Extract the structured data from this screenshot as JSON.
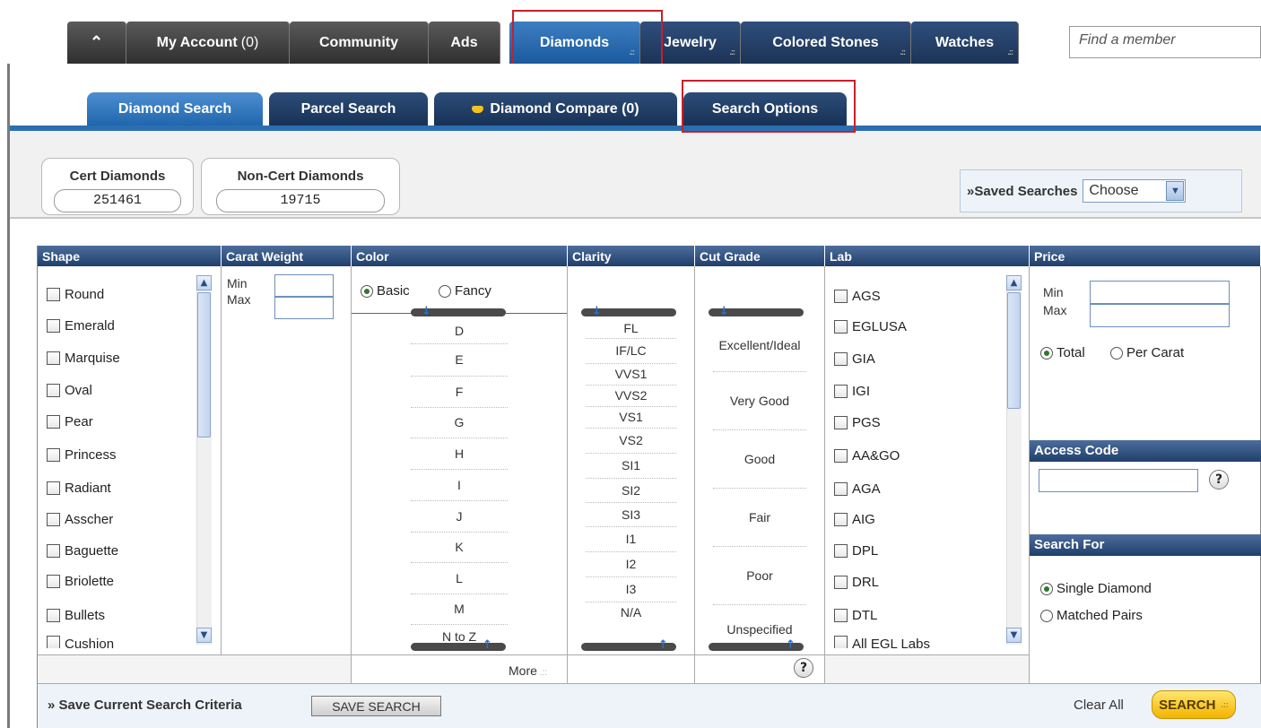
{
  "topnav": {
    "home_icon": "home-icon",
    "my_account": "My Account",
    "my_account_count": "(0)",
    "community": "Community",
    "ads": "Ads",
    "diamonds": "Diamonds",
    "jewelry": "Jewelry",
    "colored_stones": "Colored Stones",
    "watches": "Watches",
    "find_placeholder": "Find a member"
  },
  "subtabs": {
    "diamond_search": "Diamond Search",
    "parcel_search": "Parcel Search",
    "diamond_compare": "Diamond Compare (0)",
    "search_options": "Search Options"
  },
  "counts": {
    "cert_label": "Cert Diamonds",
    "cert_value": "251461",
    "noncert_label": "Non-Cert Diamonds",
    "noncert_value": "19715"
  },
  "saved": {
    "label": "Saved Searches",
    "prefix": "»",
    "choose": "Choose"
  },
  "headers": {
    "shape": "Shape",
    "carat": "Carat Weight",
    "color": "Color",
    "clarity": "Clarity",
    "cut": "Cut Grade",
    "lab": "Lab",
    "price": "Price"
  },
  "shapes": [
    "Round",
    "Emerald",
    "Marquise",
    "Oval",
    "Pear",
    "Princess",
    "Radiant",
    "Asscher",
    "Baguette",
    "Briolette",
    "Bullets",
    "Cushion"
  ],
  "carat": {
    "min": "Min",
    "max": "Max"
  },
  "color_mode": {
    "basic": "Basic",
    "fancy": "Fancy"
  },
  "colors": [
    "D",
    "E",
    "F",
    "G",
    "H",
    "I",
    "J",
    "K",
    "L",
    "M",
    "N to Z"
  ],
  "color_more": "More",
  "clarity": [
    "FL",
    "IF/LC",
    "VVS1",
    "VVS2",
    "VS1",
    "VS2",
    "SI1",
    "SI2",
    "SI3",
    "I1",
    "I2",
    "I3",
    "N/A"
  ],
  "cut": [
    "Excellent/Ideal",
    "Very Good",
    "Good",
    "Fair",
    "Poor",
    "Unspecified"
  ],
  "labs": [
    "AGS",
    "EGLUSA",
    "GIA",
    "IGI",
    "PGS",
    "AA&GO",
    "AGA",
    "AIG",
    "DPL",
    "DRL",
    "DTL",
    "All EGL Labs"
  ],
  "price": {
    "min": "Min",
    "max": "Max",
    "total": "Total",
    "per_carat": "Per Carat",
    "access_code": "Access Code",
    "search_for": "Search For",
    "single": "Single Diamond",
    "pairs": "Matched Pairs"
  },
  "help_glyph": "?",
  "footer": {
    "save_criteria": "Save Current Search Criteria",
    "save_button": "SAVE SEARCH",
    "clear_all": "Clear All",
    "search_button": "SEARCH"
  }
}
